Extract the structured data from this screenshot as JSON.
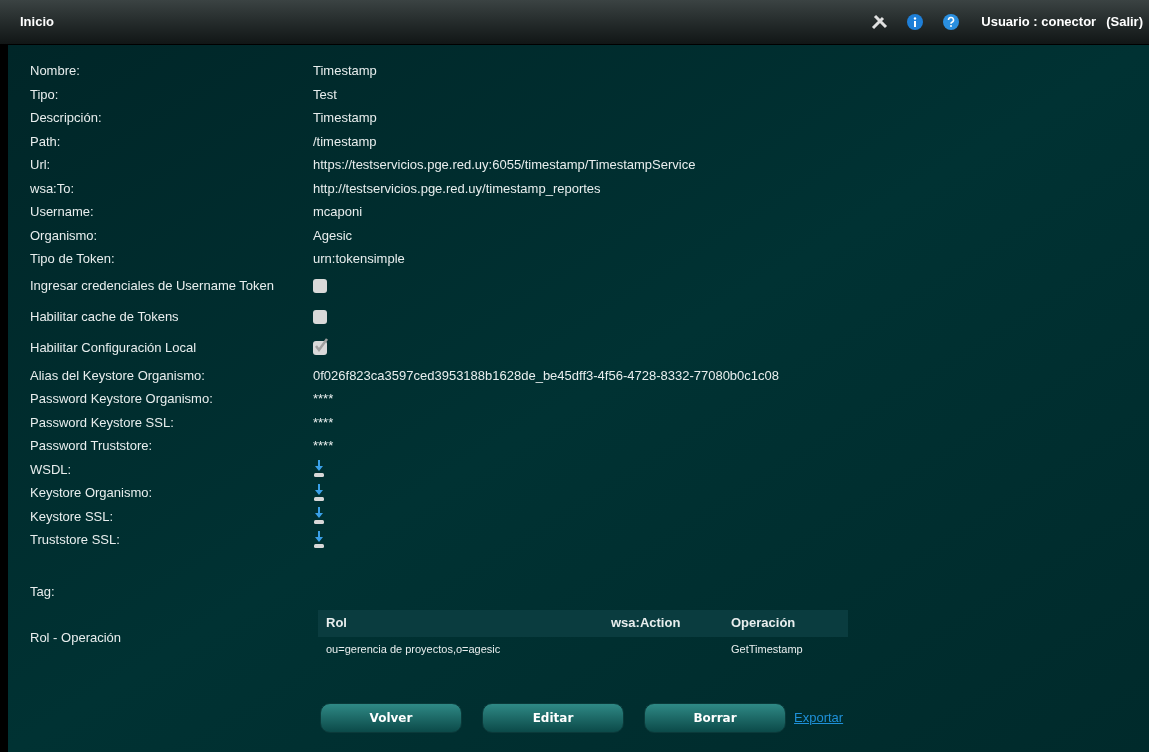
{
  "header": {
    "title": "Inicio",
    "user": "Usuario : conector",
    "logout": "(Salir)"
  },
  "fields": [
    {
      "kind": "text",
      "label": "Nombre:",
      "value": "Timestamp"
    },
    {
      "kind": "text",
      "label": "Tipo:",
      "value": "Test"
    },
    {
      "kind": "text",
      "label": "Descripción:",
      "value": "Timestamp"
    },
    {
      "kind": "text",
      "label": "Path:",
      "value": "/timestamp"
    },
    {
      "kind": "text",
      "label": "Url:",
      "value": "https://testservicios.pge.red.uy:6055/timestamp/TimestampService"
    },
    {
      "kind": "text",
      "label": "wsa:To:",
      "value": "http://testservicios.pge.red.uy/timestamp_reportes"
    },
    {
      "kind": "text",
      "label": "Username:",
      "value": "mcaponi"
    },
    {
      "kind": "text",
      "label": "Organismo:",
      "value": "Agesic"
    },
    {
      "kind": "text",
      "label": "Tipo de Token:",
      "value": "urn:tokensimple"
    },
    {
      "kind": "checkbox",
      "label": "Ingresar credenciales de Username Token",
      "checked": false
    },
    {
      "kind": "checkbox",
      "label": "Habilitar cache de Tokens",
      "checked": false
    },
    {
      "kind": "checkbox",
      "label": "Habilitar Configuración Local",
      "checked": true
    },
    {
      "kind": "text",
      "label": "Alias del Keystore Organismo:",
      "value": "0f026f823ca3597ced3953188b1628de_be45dff3-4f56-4728-8332-77080b0c1c08"
    },
    {
      "kind": "text",
      "label": "Password Keystore Organismo:",
      "value": "****"
    },
    {
      "kind": "text",
      "label": "Password Keystore SSL:",
      "value": "****"
    },
    {
      "kind": "text",
      "label": "Password Truststore:",
      "value": "****"
    },
    {
      "kind": "download",
      "label": "WSDL:"
    },
    {
      "kind": "download",
      "label": "Keystore Organismo:"
    },
    {
      "kind": "download",
      "label": "Keystore SSL:"
    },
    {
      "kind": "download",
      "label": "Truststore SSL:"
    }
  ],
  "tag": {
    "label": "Tag:"
  },
  "rol_operacion": {
    "label": "Rol - Operación",
    "columns": [
      "Rol",
      "wsa:Action",
      "Operación"
    ],
    "rows": [
      [
        "ou=gerencia de proyectos,o=agesic",
        "",
        "GetTimestamp"
      ]
    ]
  },
  "buttons": [
    "Volver",
    "Editar",
    "Borrar"
  ],
  "export_link": "Exportar"
}
